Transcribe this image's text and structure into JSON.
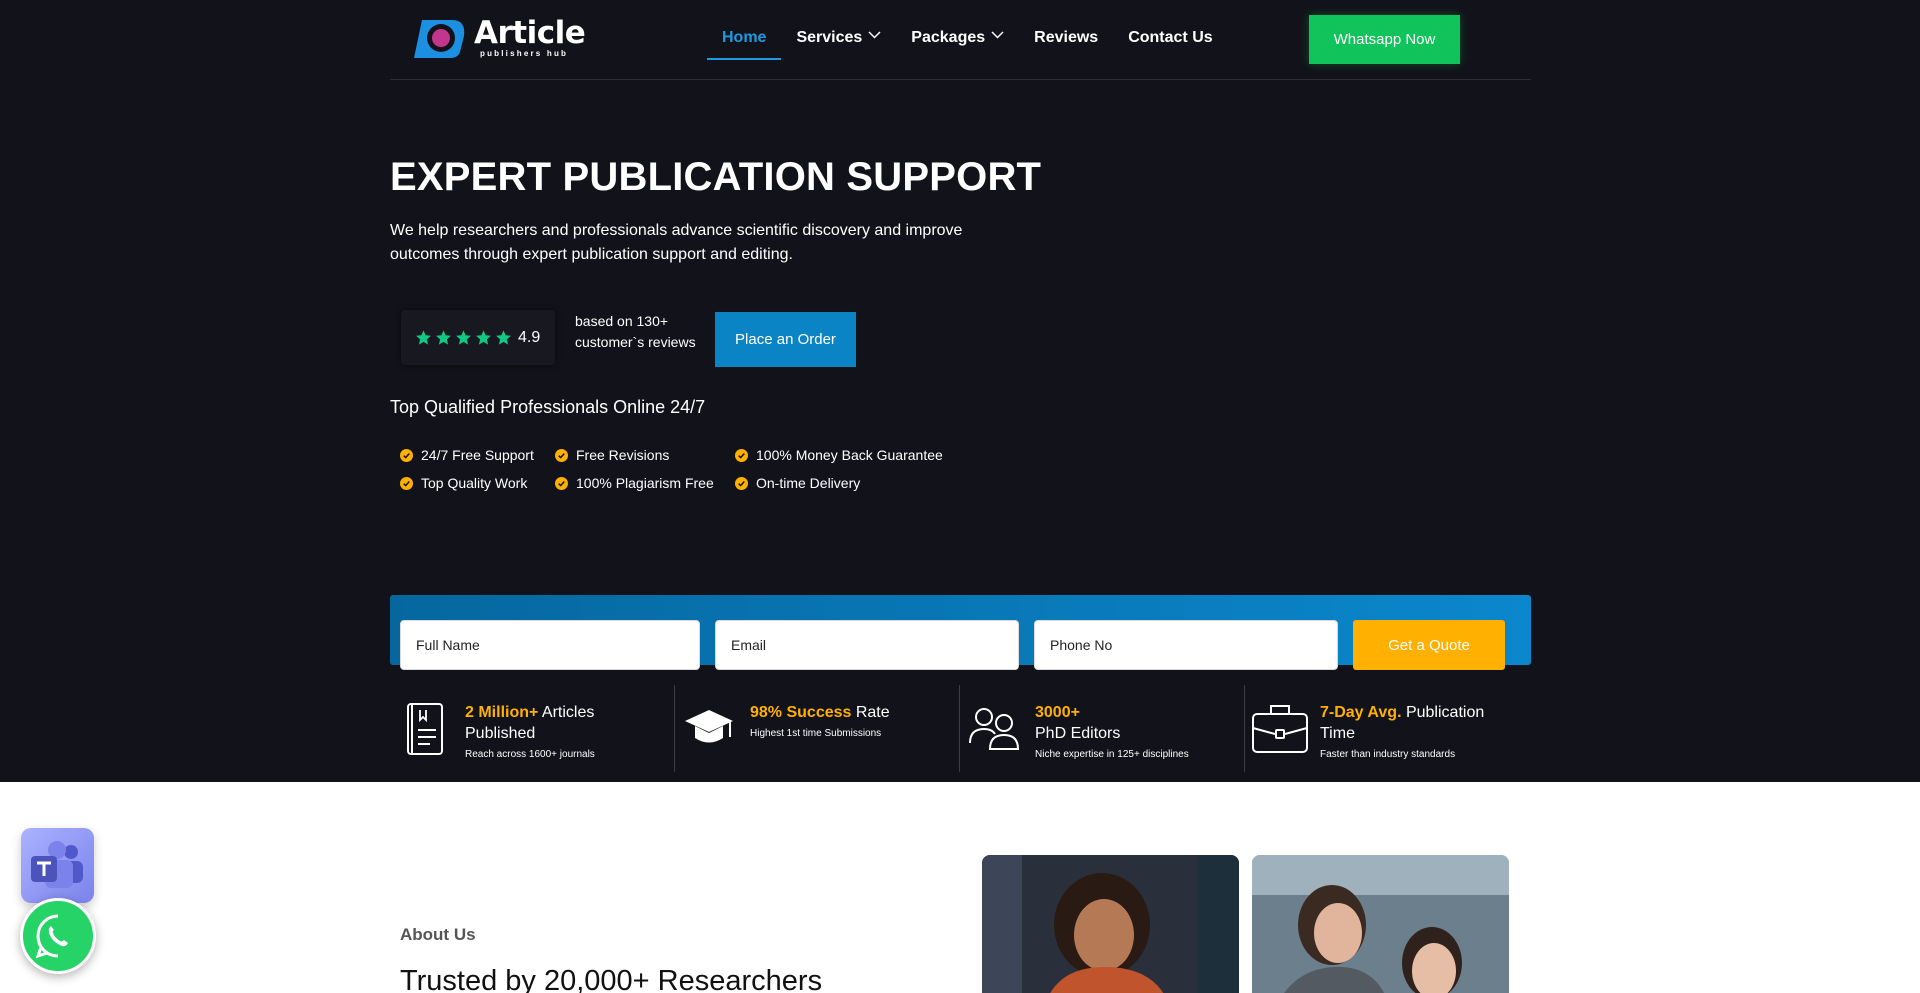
{
  "brand": {
    "name": "Article",
    "tagline": "publishers hub"
  },
  "nav": {
    "items": [
      {
        "label": "Home",
        "active": true,
        "dropdown": false
      },
      {
        "label": "Services",
        "active": false,
        "dropdown": true
      },
      {
        "label": "Packages",
        "active": false,
        "dropdown": true
      },
      {
        "label": "Reviews",
        "active": false,
        "dropdown": false
      },
      {
        "label": "Contact Us",
        "active": false,
        "dropdown": false
      }
    ],
    "cta": "Whatsapp Now"
  },
  "hero": {
    "title": "EXPERT PUBLICATION SUPPORT",
    "description": "We help researchers and professionals advance scientific discovery and improve outcomes through expert publication support and editing.",
    "rating": {
      "stars": 5,
      "value": "4.9"
    },
    "reviews_line1": "based on 130+",
    "reviews_line2": "customer`s reviews",
    "order_button": "Place an Order",
    "pros_title": "Top Qualified Professionals Online 24/7",
    "features": [
      "24/7 Free Support",
      "Free Revisions",
      "100% Money Back Guarantee",
      "Top Quality Work",
      "100% Plagiarism Free",
      "On-time Delivery"
    ]
  },
  "quote_form": {
    "name_placeholder": "Full Name",
    "email_placeholder": "Email",
    "phone_placeholder": "Phone No",
    "submit": "Get a Quote"
  },
  "stats": [
    {
      "icon": "book-icon",
      "highlight": "2 Million+",
      "rest": " Articles Published",
      "sub": "Reach across 1600+ journals"
    },
    {
      "icon": "graduation-cap-icon",
      "highlight": "98% Success",
      "rest": " Rate",
      "sub": "Highest 1st time Submissions"
    },
    {
      "icon": "editors-icon",
      "highlight": "3000+",
      "rest": " PhD Editors",
      "sub": "Niche expertise in 125+ disciplines"
    },
    {
      "icon": "briefcase-icon",
      "highlight": "7-Day Avg.",
      "rest": " Publication Time",
      "sub": "Faster than industry standards"
    }
  ],
  "about": {
    "tag": " About Us",
    "title": "Trusted by 20,000+ Researchers"
  },
  "colors": {
    "hero_bg": "#12131a",
    "accent_blue": "#0b84c6",
    "whatsapp_green": "#10c35a",
    "highlight_yellow": "#ffb000"
  }
}
